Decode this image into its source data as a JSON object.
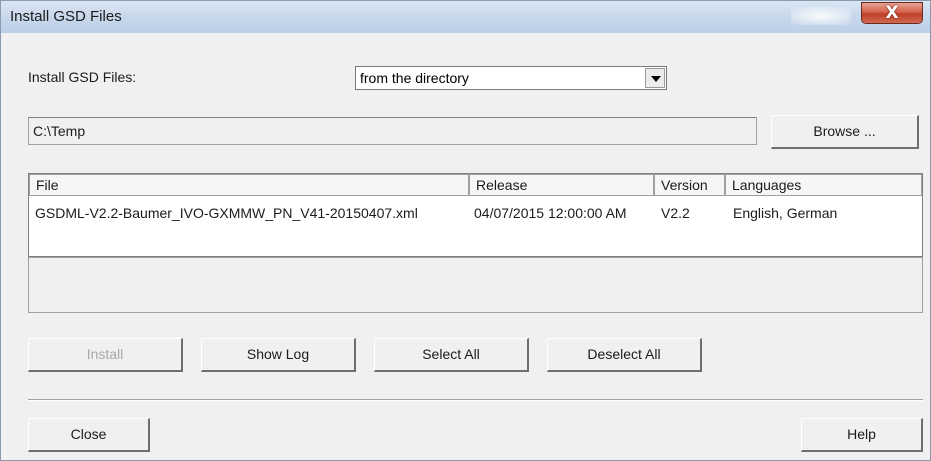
{
  "window": {
    "title": "Install GSD Files",
    "close_symbol": "X"
  },
  "source": {
    "label": "Install GSD Files:",
    "selected": "from the directory",
    "path": "C:\\Temp",
    "browse_label": "Browse ..."
  },
  "table": {
    "columns": [
      "File",
      "Release",
      "Version",
      "Languages"
    ],
    "rows": [
      {
        "file": "GSDML-V2.2-Baumer_IVO-GXMMW_PN_V41-20150407.xml",
        "release": "04/07/2015 12:00:00 AM",
        "version": "V2.2",
        "languages": "English, German"
      }
    ]
  },
  "actions": {
    "install": "Install",
    "show_log": "Show Log",
    "select_all": "Select All",
    "deselect_all": "Deselect All"
  },
  "footer": {
    "close": "Close",
    "help": "Help"
  }
}
